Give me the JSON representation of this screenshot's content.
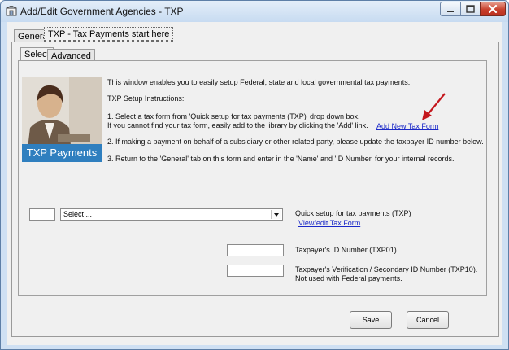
{
  "window": {
    "title": "Add/Edit Government Agencies - TXP"
  },
  "tabs": [
    {
      "label": "General"
    },
    {
      "label": "TXP - Tax Payments start here"
    }
  ],
  "subtabs": [
    {
      "label": "Select"
    },
    {
      "label": "Advanced"
    }
  ],
  "banner": {
    "label": "TXP Payments"
  },
  "intro": {
    "line1": "This window enables you to easily setup Federal, state and local governmental tax payments.",
    "heading": "TXP Setup Instructions:",
    "step1a": "1. Select a tax form from 'Quick setup for tax payments (TXP)' drop down box.",
    "step1b": "If you cannot find your tax form, easily add to the library by clicking the 'Add' link.",
    "add_link": "Add New Tax Form",
    "step2": "2. If making a payment on behalf of a subsidiary or other related party, please update the taxpayer ID number below.",
    "step3": "3. Return to the 'General' tab on this form and enter in the 'Name' and 'ID Number' for your internal records."
  },
  "form": {
    "code_value": "",
    "select_value": "Select ...",
    "quick_setup_label": "Quick setup for tax payments (TXP)",
    "view_link": "View/edit Tax Form",
    "txp01_label": "Taxpayer's ID Number (TXP01)",
    "txp01_value": "",
    "txp10_label": "Taxpayer's Verification / Secondary ID Number (TXP10).",
    "txp10_note": "Not used with Federal payments.",
    "txp10_value": ""
  },
  "buttons": {
    "save": "Save",
    "cancel": "Cancel"
  },
  "colors": {
    "link": "#1a28c8",
    "arrow": "#c4161c",
    "banner": "#2f7fbf"
  }
}
